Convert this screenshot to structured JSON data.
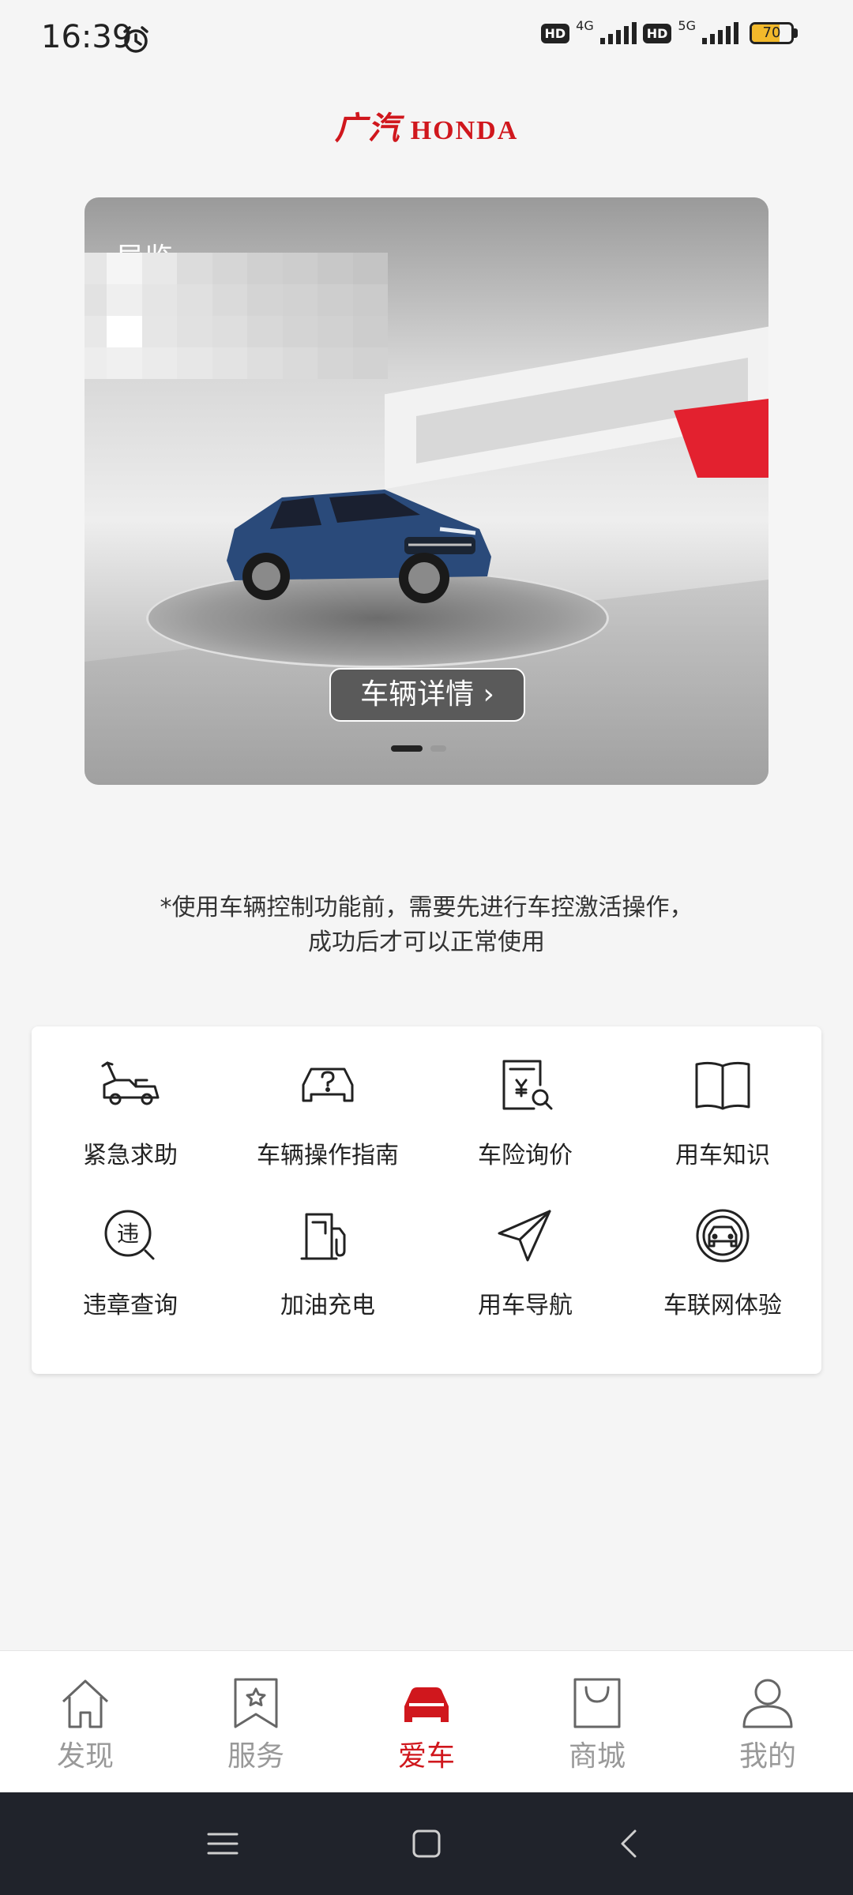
{
  "status_bar": {
    "time": "16:39",
    "hd_label": "HD",
    "net1": "4G",
    "net2": "5G",
    "battery": "70",
    "battery_level": 0.7
  },
  "logo": {
    "chinese": "广汽",
    "english": "HONDA"
  },
  "banner": {
    "top_link": "导览",
    "detail_button": "车辆详情",
    "page_indicator": {
      "active": 1,
      "count": 2
    },
    "accent_color": "#e3212f"
  },
  "notice": {
    "line1": "*使用车辆控制功能前，需要先进行车控激活操作，",
    "line2": "成功后才可以正常使用"
  },
  "services": [
    {
      "label": "紧急求助",
      "icon": "tow-truck-icon"
    },
    {
      "label": "车辆操作指南",
      "icon": "car-question-icon"
    },
    {
      "label": "车险询价",
      "icon": "insurance-quote-icon"
    },
    {
      "label": "用车知识",
      "icon": "book-icon"
    },
    {
      "label": "违章查询",
      "icon": "violation-search-icon"
    },
    {
      "label": "加油充电",
      "icon": "fuel-pump-icon"
    },
    {
      "label": "用车导航",
      "icon": "navigation-icon"
    },
    {
      "label": "车联网体验",
      "icon": "connected-car-icon"
    }
  ],
  "bottom_nav": [
    {
      "label": "发现",
      "icon": "home-icon",
      "active": false
    },
    {
      "label": "服务",
      "icon": "service-bookmark-icon",
      "active": false
    },
    {
      "label": "爱车",
      "icon": "car-icon",
      "active": true
    },
    {
      "label": "商城",
      "icon": "shopping-bag-icon",
      "active": false
    },
    {
      "label": "我的",
      "icon": "user-icon",
      "active": false
    }
  ],
  "colors": {
    "brand_red": "#d0171d",
    "nav_inactive": "#999999",
    "system_nav_bg": "#20232b"
  }
}
